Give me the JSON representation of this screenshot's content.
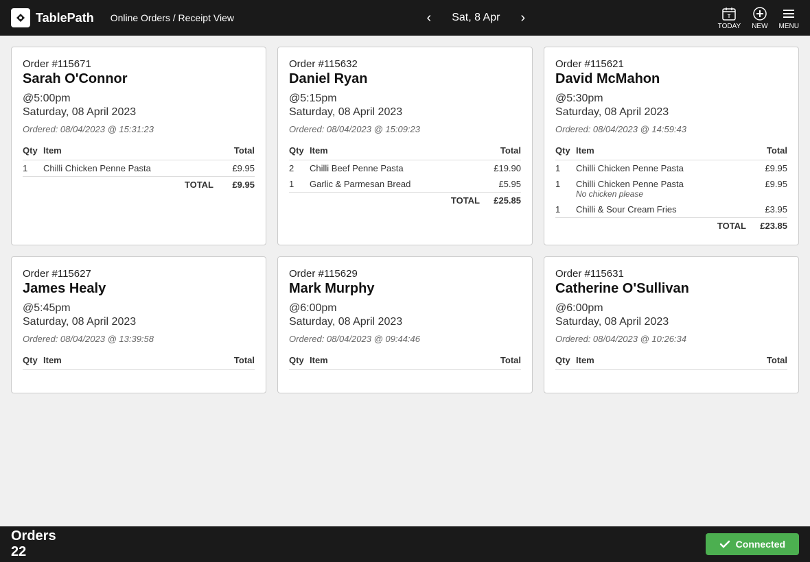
{
  "header": {
    "logo_text": "TablePath",
    "breadcrumb_part1": "Online Orders",
    "breadcrumb_separator": " / ",
    "breadcrumb_part2": "Receipt View",
    "date": "Sat, 8 Apr",
    "today_label": "TODAY",
    "new_label": "NEW",
    "menu_label": "MENU"
  },
  "footer": {
    "orders_label": "Orders",
    "orders_count": "22",
    "connected_label": "Connected"
  },
  "orders": [
    {
      "id": "order-115671",
      "number": "Order #115671",
      "name": "Sarah O'Connor",
      "time": "@5:00pm",
      "date": "Saturday, 08 April 2023",
      "placed": "Ordered: 08/04/2023 @ 15:31:23",
      "items": [
        {
          "qty": "1",
          "item": "Chilli Chicken Penne Pasta",
          "note": "",
          "total": "£9.95"
        }
      ],
      "total": "£9.95"
    },
    {
      "id": "order-115632",
      "number": "Order #115632",
      "name": "Daniel Ryan",
      "time": "@5:15pm",
      "date": "Saturday, 08 April 2023",
      "placed": "Ordered: 08/04/2023 @ 15:09:23",
      "items": [
        {
          "qty": "2",
          "item": "Chilli Beef Penne Pasta",
          "note": "",
          "total": "£19.90"
        },
        {
          "qty": "1",
          "item": "Garlic & Parmesan Bread",
          "note": "",
          "total": "£5.95"
        }
      ],
      "total": "£25.85"
    },
    {
      "id": "order-115621",
      "number": "Order #115621",
      "name": "David McMahon",
      "time": "@5:30pm",
      "date": "Saturday, 08 April 2023",
      "placed": "Ordered: 08/04/2023 @ 14:59:43",
      "items": [
        {
          "qty": "1",
          "item": "Chilli Chicken Penne Pasta",
          "note": "",
          "total": "£9.95"
        },
        {
          "qty": "1",
          "item": "Chilli Chicken Penne Pasta",
          "note": "No chicken please",
          "total": "£9.95"
        },
        {
          "qty": "1",
          "item": "Chilli & Sour Cream Fries",
          "note": "",
          "total": "£3.95"
        }
      ],
      "total": "£23.85"
    },
    {
      "id": "order-115627",
      "number": "Order #115627",
      "name": "James Healy",
      "time": "@5:45pm",
      "date": "Saturday, 08 April 2023",
      "placed": "Ordered: 08/04/2023 @ 13:39:58",
      "items": [],
      "total": ""
    },
    {
      "id": "order-115629",
      "number": "Order #115629",
      "name": "Mark Murphy",
      "time": "@6:00pm",
      "date": "Saturday, 08 April 2023",
      "placed": "Ordered: 08/04/2023 @ 09:44:46",
      "items": [],
      "total": ""
    },
    {
      "id": "order-115631",
      "number": "Order #115631",
      "name": "Catherine O'Sullivan",
      "time": "@6:00pm",
      "date": "Saturday, 08 April 2023",
      "placed": "Ordered: 08/04/2023 @ 10:26:34",
      "items": [],
      "total": ""
    }
  ],
  "table_headers": {
    "qty": "Qty",
    "item": "Item",
    "total": "Total"
  }
}
